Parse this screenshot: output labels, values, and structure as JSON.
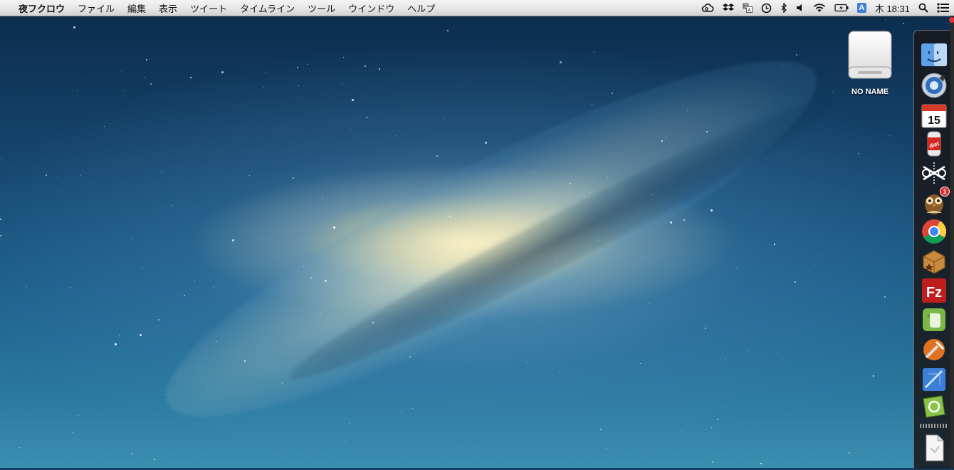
{
  "menubar": {
    "apple_glyph": "",
    "app_name": "夜フクロウ",
    "menus": [
      "ファイル",
      "編集",
      "表示",
      "ツイート",
      "タイムライン",
      "ツール",
      "ウインドウ",
      "ヘルプ"
    ],
    "status": {
      "input_badge": "A",
      "clock": "木 18:31"
    }
  },
  "desktop": {
    "drive_label": "NO NAME"
  },
  "dock": {
    "items": [
      {
        "name": "finder-icon"
      },
      {
        "name": "itunes-icon"
      },
      {
        "name": "calendar-icon",
        "text": "15"
      },
      {
        "name": "diet-coda-icon",
        "text": "diet"
      },
      {
        "name": "mail-scissors-icon"
      },
      {
        "name": "owl-twitter-icon",
        "badge": "1"
      },
      {
        "name": "chrome-icon"
      },
      {
        "name": "package-icon"
      },
      {
        "name": "filezilla-icon",
        "text": "Fz"
      },
      {
        "name": "evernote-icon"
      },
      {
        "name": "tools-icon"
      },
      {
        "name": "xcode-icon"
      },
      {
        "name": "coda-icon"
      },
      {
        "name": "document-icon"
      }
    ]
  },
  "colors": {
    "menubar_top": "#f4f4f4",
    "menubar_bottom": "#d2d2d2",
    "dock_bg": "#19191e",
    "wallpaper_core": "#fff0be",
    "wallpaper_sky": "#14426a"
  }
}
